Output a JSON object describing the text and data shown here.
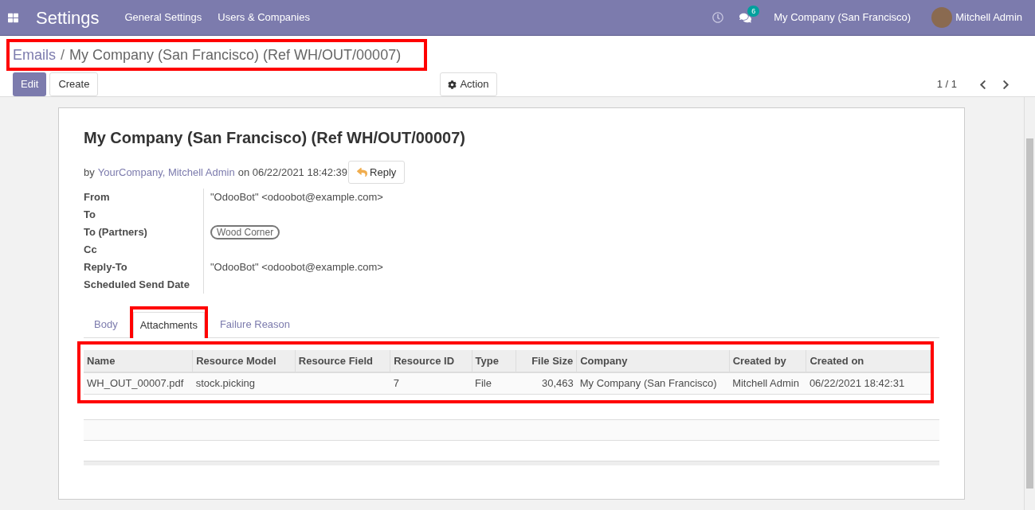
{
  "navbar": {
    "app_title": "Settings",
    "menu": [
      "General Settings",
      "Users & Companies"
    ],
    "messages_badge": "6",
    "company": "My Company (San Francisco)",
    "user": "Mitchell Admin"
  },
  "breadcrumb": {
    "parent": "Emails",
    "separator": "/",
    "current": "My Company (San Francisco) (Ref WH/OUT/00007)"
  },
  "buttons": {
    "edit": "Edit",
    "create": "Create",
    "action": "Action"
  },
  "pager": {
    "value": "1 / 1"
  },
  "sheet": {
    "title": "My Company (San Francisco) (Ref WH/OUT/00007)",
    "by": "by",
    "authors": "YourCompany, Mitchell Admin",
    "on": "on 06/22/2021 18:42:39",
    "reply": "Reply",
    "fields": [
      {
        "label": "From",
        "kind": "text",
        "value": "\"OdooBot\" <odoobot@example.com>"
      },
      {
        "label": "To",
        "kind": "empty"
      },
      {
        "label": "To (Partners)",
        "kind": "tag",
        "value": "Wood Corner"
      },
      {
        "label": "Cc",
        "kind": "empty"
      },
      {
        "label": "Reply-To",
        "kind": "text",
        "value": "\"OdooBot\" <odoobot@example.com>"
      },
      {
        "label": "Scheduled Send Date",
        "kind": "empty"
      }
    ],
    "tabs": [
      {
        "label": "Body",
        "selected": false
      },
      {
        "label": "Attachments",
        "selected": true
      },
      {
        "label": "Failure Reason",
        "selected": false
      }
    ],
    "table": {
      "columns": [
        "Name",
        "Resource Model",
        "Resource Field",
        "Resource ID",
        "Type",
        "File Size",
        "Company",
        "Created by",
        "Created on"
      ],
      "rows": [
        [
          "WH_OUT_00007.pdf",
          "stock.picking",
          "",
          "7",
          "File",
          "30,463",
          "My Company (San Francisco)",
          "Mitchell Admin",
          "06/22/2021 18:42:31"
        ]
      ]
    }
  }
}
